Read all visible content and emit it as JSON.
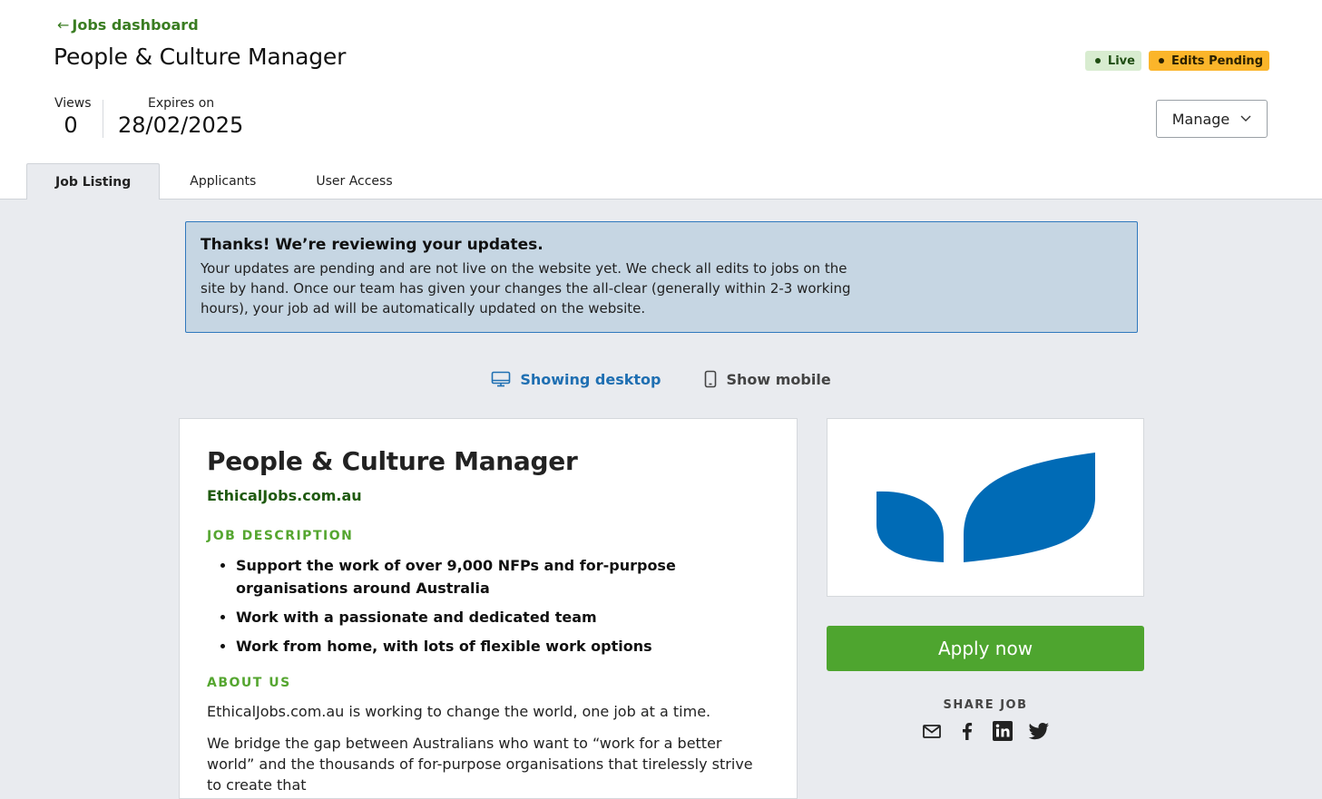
{
  "header": {
    "back_label": "Jobs dashboard",
    "title": "People & Culture Manager",
    "badges": {
      "live": "Live",
      "pending": "Edits Pending"
    },
    "stats": {
      "views_label": "Views",
      "views_value": "0",
      "expires_label": "Expires on",
      "expires_value": "28/02/2025"
    },
    "manage_label": "Manage"
  },
  "tabs": [
    {
      "label": "Job Listing",
      "active": true
    },
    {
      "label": "Applicants",
      "active": false
    },
    {
      "label": "User Access",
      "active": false
    }
  ],
  "notice": {
    "title": "Thanks! We’re reviewing your updates.",
    "body": "Your updates are pending and are not live on the website yet. We check all edits to jobs on the site by hand. Once our team has given your changes the all-clear (generally within 2-3 working hours), your job ad will be automatically updated on the website."
  },
  "view_toggle": {
    "desktop": "Showing desktop",
    "mobile": "Show mobile"
  },
  "job": {
    "title": "People & Culture Manager",
    "company": "EthicalJobs.com.au",
    "description_heading": "JOB DESCRIPTION",
    "bullets": [
      "Support the work of over 9,000 NFPs and for-purpose organisations around Australia",
      "Work with a passionate and dedicated team",
      "Work from home, with lots of flexible work options"
    ],
    "about_heading": "ABOUT US",
    "about_paragraphs": [
      "EthicalJobs.com.au is working to change the world, one job at a time.",
      "We bridge the gap between Australians who want to “work for a better world” and the thousands of for-purpose organisations that tirelessly strive to create that"
    ]
  },
  "sidebar": {
    "apply_label": "Apply now",
    "share_label": "SHARE JOB",
    "share_icons": [
      "email-icon",
      "facebook-icon",
      "linkedin-icon",
      "twitter-icon"
    ]
  },
  "colors": {
    "accent_green": "#4ea52f",
    "link_green": "#3a7d22",
    "live_bg": "#d8ecd0",
    "pending_bg": "#fbb52a",
    "notice_bg": "#c6d6e3",
    "notice_border": "#2f78bd",
    "brand_blue": "#006bb6",
    "page_bg": "#e9ebef"
  }
}
